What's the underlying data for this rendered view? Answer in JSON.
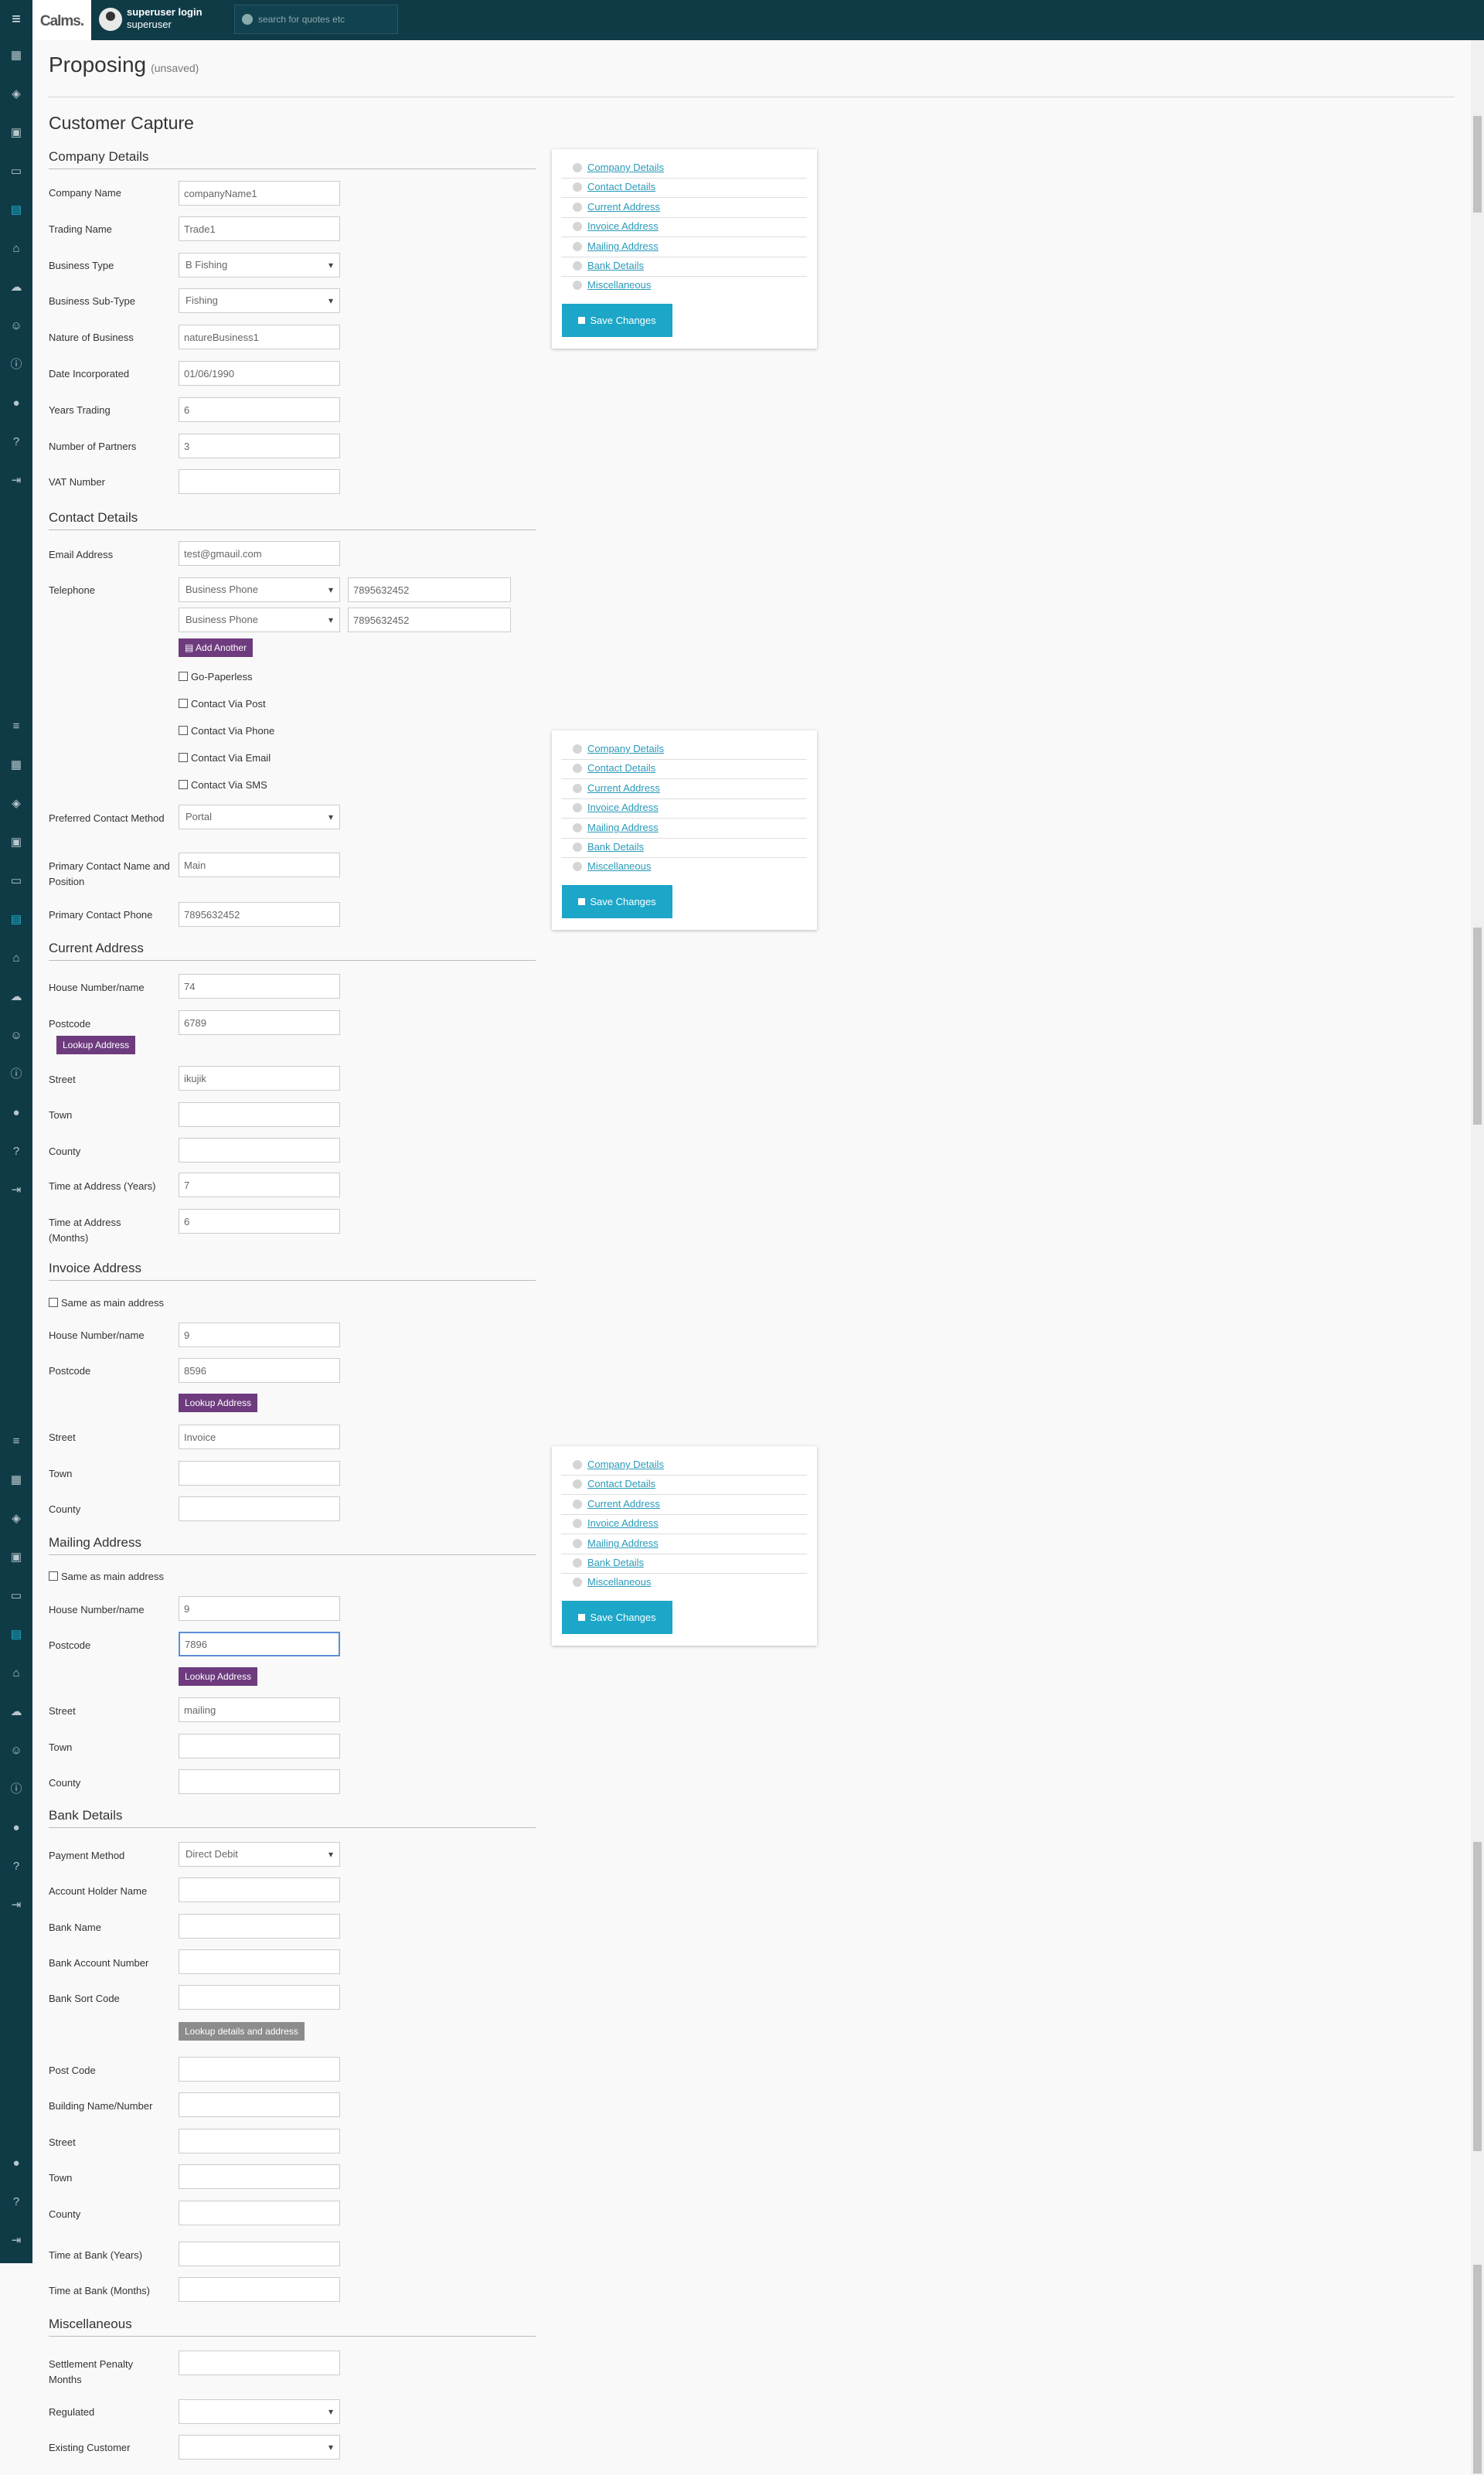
{
  "header": {
    "logo": "Calms.",
    "user_name": "superuser login",
    "user_role": "superuser",
    "search_placeholder": "search for quotes etc"
  },
  "page": {
    "title": "Proposing",
    "status": "(unsaved)",
    "section_title": "Customer Capture"
  },
  "sections": {
    "company": "Company Details",
    "contact": "Contact Details",
    "current": "Current Address",
    "invoice": "Invoice Address",
    "mailing": "Mailing Address",
    "bank": "Bank Details",
    "misc": "Miscellaneous"
  },
  "company": {
    "company_name_label": "Company Name",
    "company_name": "companyName1",
    "trading_name_label": "Trading Name",
    "trading_name": "Trade1",
    "business_type_label": "Business Type",
    "business_type": "B Fishing",
    "business_subtype_label": "Business Sub-Type",
    "business_subtype": "Fishing",
    "nature_label": "Nature of Business",
    "nature": "natureBusiness1",
    "date_inc_label": "Date Incorporated",
    "date_inc": "01/06/1990",
    "years_trading_label": "Years Trading",
    "years_trading": "6",
    "partners_label": "Number of Partners",
    "partners": "3",
    "vat_label": "VAT Number",
    "vat": ""
  },
  "contact": {
    "email_label": "Email Address",
    "email": "test@gmauil.com",
    "telephone_label": "Telephone",
    "phones": [
      {
        "type": "Business Phone",
        "number": "7895632452"
      },
      {
        "type": "Business Phone",
        "number": "7895632452"
      }
    ],
    "add_another": "Add Another",
    "go_paperless": "Go-Paperless",
    "via_post": "Contact Via Post",
    "via_phone": "Contact Via Phone",
    "via_email": "Contact Via Email",
    "via_sms": "Contact Via SMS",
    "preferred_label": "Preferred Contact Method",
    "preferred": "Portal",
    "primary_name_label": "Primary Contact Name and Position",
    "primary_name": "Main",
    "primary_phone_label": "Primary Contact Phone",
    "primary_phone": "7895632452"
  },
  "current": {
    "house_label": "House Number/name",
    "house": "74",
    "postcode_label": "Postcode",
    "postcode": "6789",
    "lookup": "Lookup Address",
    "street_label": "Street",
    "street": "ikujik",
    "town_label": "Town",
    "town": "",
    "county_label": "County",
    "county": "",
    "years_label": "Time at Address (Years)",
    "years": "7",
    "months_label": "Time at Address (Months)",
    "months": "6"
  },
  "invoice": {
    "same": "Same as main address",
    "house_label": "House Number/name",
    "house": "9",
    "postcode_label": "Postcode",
    "postcode": "8596",
    "lookup": "Lookup Address",
    "street_label": "Street",
    "street": "Invoice",
    "town_label": "Town",
    "town": "",
    "county_label": "County",
    "county": ""
  },
  "mailing": {
    "same": "Same as main address",
    "house_label": "House Number/name",
    "house": "9",
    "postcode_label": "Postcode",
    "postcode": "7896",
    "lookup": "Lookup Address",
    "street_label": "Street",
    "street": "mailing",
    "town_label": "Town",
    "town": "",
    "county_label": "County",
    "county": ""
  },
  "bank": {
    "payment_label": "Payment Method",
    "payment": "Direct Debit",
    "holder_label": "Account Holder Name",
    "bank_name_label": "Bank Name",
    "account_label": "Bank Account Number",
    "sort_label": "Bank Sort Code",
    "lookup": "Lookup details and address",
    "postcode_label": "Post Code",
    "building_label": "Building Name/Number",
    "street_label": "Street",
    "town_label": "Town",
    "county_label": "County",
    "years_label": "Time at Bank (Years)",
    "months_label": "Time at Bank (Months)"
  },
  "misc": {
    "penalty_label": "Settlement Penalty Months",
    "regulated_label": "Regulated",
    "existing_label": "Existing Customer"
  },
  "panel": {
    "links": [
      "Company Details",
      "Contact Details",
      "Current Address",
      "Invoice Address",
      "Mailing Address",
      "Bank Details",
      "Miscellaneous"
    ],
    "save": "Save Changes"
  },
  "sidebar_icons": [
    "menu-icon",
    "dashboard-icon",
    "layers-icon",
    "wallet-icon",
    "message-icon",
    "contact-card-icon",
    "bank-icon",
    "cloud-upload-icon",
    "users-icon",
    "info-icon",
    "user-icon",
    "help-icon",
    "logout-icon"
  ],
  "colors": {
    "topbar": "#0f3b47",
    "accent": "#1ca6c8",
    "button_purple": "#6e3b7e"
  }
}
